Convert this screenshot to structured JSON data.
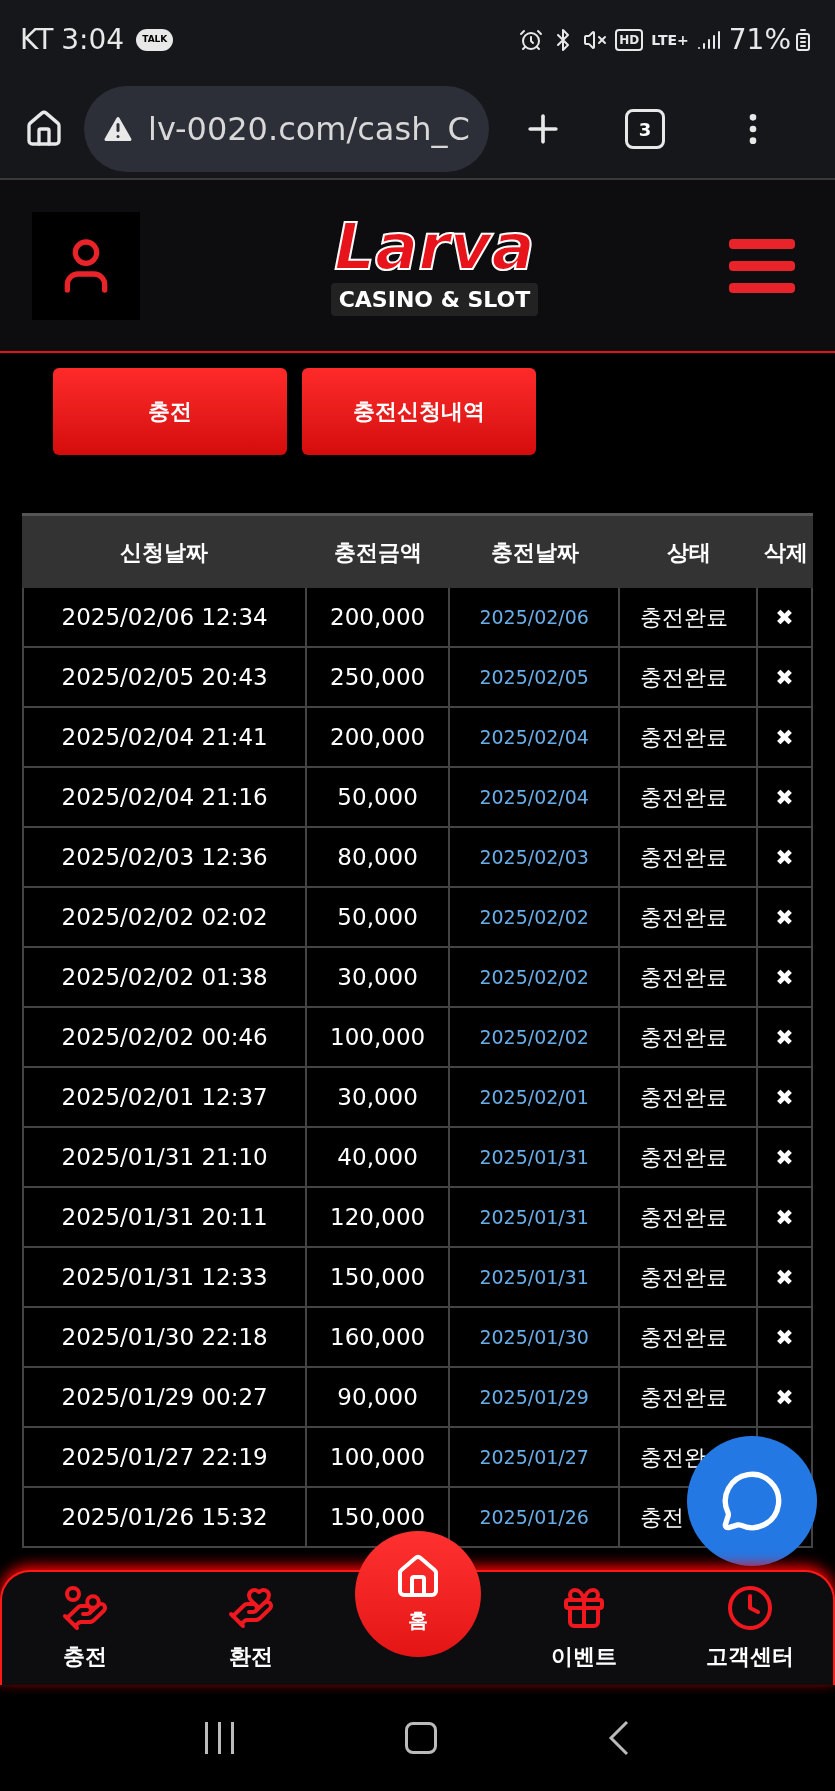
{
  "status_bar": {
    "carrier": "KT",
    "time": "3:04",
    "talk_badge": "TALK",
    "hd_badge": "HD",
    "network": "LTE+",
    "battery": "71%"
  },
  "browser": {
    "url": "lv-0020.com/cash_C",
    "tab_count": "3"
  },
  "logo": {
    "title": "Larva",
    "subtitle": "CASINO & SLOT"
  },
  "action_buttons": [
    "충전",
    "충전신청내역"
  ],
  "table": {
    "columns": [
      "신청날짜",
      "충전금액",
      "충전날짜",
      "상태",
      "삭제"
    ],
    "rows": [
      {
        "requested": "2025/02/06 12:34",
        "amount": "200,000",
        "charged": "2025/02/06",
        "status": "충전완료",
        "delete": "✖"
      },
      {
        "requested": "2025/02/05 20:43",
        "amount": "250,000",
        "charged": "2025/02/05",
        "status": "충전완료",
        "delete": "✖"
      },
      {
        "requested": "2025/02/04 21:41",
        "amount": "200,000",
        "charged": "2025/02/04",
        "status": "충전완료",
        "delete": "✖"
      },
      {
        "requested": "2025/02/04 21:16",
        "amount": "50,000",
        "charged": "2025/02/04",
        "status": "충전완료",
        "delete": "✖"
      },
      {
        "requested": "2025/02/03 12:36",
        "amount": "80,000",
        "charged": "2025/02/03",
        "status": "충전완료",
        "delete": "✖"
      },
      {
        "requested": "2025/02/02 02:02",
        "amount": "50,000",
        "charged": "2025/02/02",
        "status": "충전완료",
        "delete": "✖"
      },
      {
        "requested": "2025/02/02 01:38",
        "amount": "30,000",
        "charged": "2025/02/02",
        "status": "충전완료",
        "delete": "✖"
      },
      {
        "requested": "2025/02/02 00:46",
        "amount": "100,000",
        "charged": "2025/02/02",
        "status": "충전완료",
        "delete": "✖"
      },
      {
        "requested": "2025/02/01 12:37",
        "amount": "30,000",
        "charged": "2025/02/01",
        "status": "충전완료",
        "delete": "✖"
      },
      {
        "requested": "2025/01/31 21:10",
        "amount": "40,000",
        "charged": "2025/01/31",
        "status": "충전완료",
        "delete": "✖"
      },
      {
        "requested": "2025/01/31 20:11",
        "amount": "120,000",
        "charged": "2025/01/31",
        "status": "충전완료",
        "delete": "✖"
      },
      {
        "requested": "2025/01/31 12:33",
        "amount": "150,000",
        "charged": "2025/01/31",
        "status": "충전완료",
        "delete": "✖"
      },
      {
        "requested": "2025/01/30 22:18",
        "amount": "160,000",
        "charged": "2025/01/30",
        "status": "충전완료",
        "delete": "✖"
      },
      {
        "requested": "2025/01/29 00:27",
        "amount": "90,000",
        "charged": "2025/01/29",
        "status": "충전완료",
        "delete": "✖"
      },
      {
        "requested": "2025/01/27 22:19",
        "amount": "100,000",
        "charged": "2025/01/27",
        "status": "충전완"
      },
      {
        "requested": "2025/01/26 15:32",
        "amount": "150,000",
        "charged": "2025/01/26",
        "status": "충전"
      }
    ]
  },
  "bottom_nav": [
    {
      "kind": "deposit",
      "label": "충전",
      "selected": false
    },
    {
      "kind": "withdraw",
      "label": "환전",
      "selected": false
    },
    {
      "kind": "home",
      "label": "홈",
      "selected": true
    },
    {
      "kind": "event",
      "label": "이벤트",
      "selected": false
    },
    {
      "kind": "support",
      "label": "고객센터",
      "selected": false
    }
  ]
}
